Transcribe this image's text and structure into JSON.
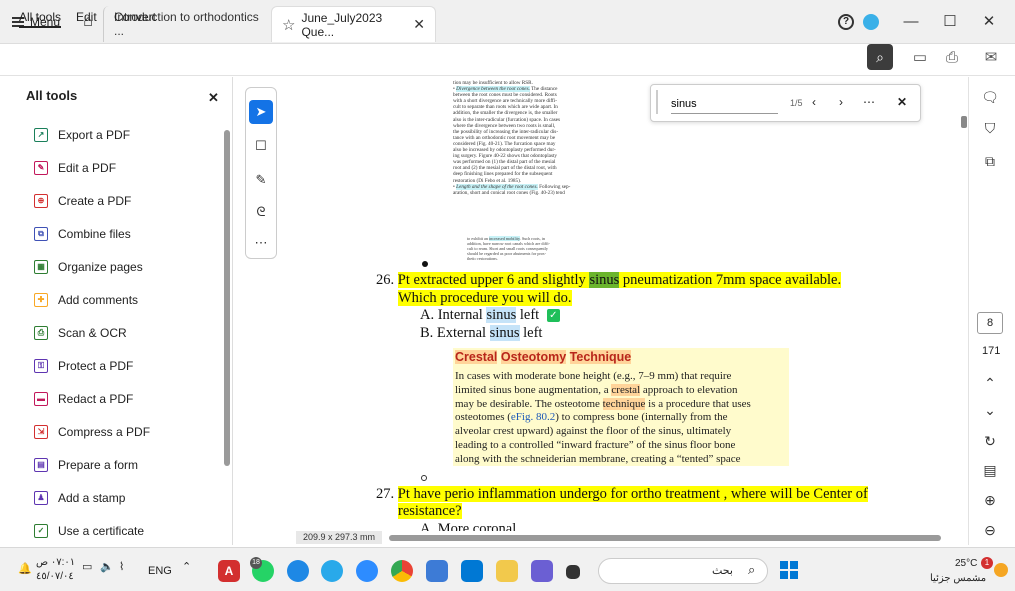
{
  "titlebar": {
    "menu_label": "Menu",
    "tabs": [
      {
        "label": "Introduction to orthodontics ..."
      },
      {
        "label": "June_July2023 Que..."
      }
    ],
    "window_controls": [
      "minimize",
      "maximize",
      "close"
    ]
  },
  "menubar": {
    "items": [
      "All tools",
      "Edit",
      "Convert"
    ]
  },
  "left_panel": {
    "title": "All tools",
    "tools": [
      {
        "label": "Export a PDF",
        "icon": "export-pdf-icon",
        "color": "#1a7f5a"
      },
      {
        "label": "Edit a PDF",
        "icon": "edit-pdf-icon",
        "color": "#c2185b"
      },
      {
        "label": "Create a PDF",
        "icon": "create-pdf-icon",
        "color": "#d32f2f"
      },
      {
        "label": "Combine files",
        "icon": "combine-files-icon",
        "color": "#3f51b5"
      },
      {
        "label": "Organize pages",
        "icon": "organize-pages-icon",
        "color": "#2e7d32"
      },
      {
        "label": "Add comments",
        "icon": "add-comments-icon",
        "color": "#f9a825"
      },
      {
        "label": "Scan & OCR",
        "icon": "scan-ocr-icon",
        "color": "#2e7d32"
      },
      {
        "label": "Protect a PDF",
        "icon": "protect-pdf-icon",
        "color": "#5e35b1"
      },
      {
        "label": "Redact a PDF",
        "icon": "redact-pdf-icon",
        "color": "#c2185b"
      },
      {
        "label": "Compress a PDF",
        "icon": "compress-pdf-icon",
        "color": "#d32f2f"
      },
      {
        "label": "Prepare a form",
        "icon": "prepare-form-icon",
        "color": "#5e35b1"
      },
      {
        "label": "Add a stamp",
        "icon": "add-stamp-icon",
        "color": "#5e35b1"
      },
      {
        "label": "Use a certificate",
        "icon": "certificate-icon",
        "color": "#2e7d32"
      }
    ]
  },
  "find": {
    "query": "sinus",
    "count": "1/5"
  },
  "document": {
    "scan_lines": [
      "tion may be insufficient to allow RSR.",
      "The distance",
      "between the root cones must be considered. Roots",
      "with a short divergence are technically more diffi-",
      "cult to separate than roots which are wide apart. In",
      "addition, the smaller the divergence is, the smaller",
      "also is the inter-radicular (furcation) space. In cases",
      "where the divergence between two roots is small,",
      "the possibility of increasing the inter-radicular dis-",
      "tance with an orthodontic root movement may be",
      "considered (Fig. 40-21). The furcation space may",
      "also be increased by odontoplasty performed dur-",
      "ing surgery. Figure 40-22 shows that odontoplasty",
      "was performed on (1) the distal part of the mesial",
      "root and (2) the mesial part of the distal root, with",
      "deep finishing lines prepared for the subsequent",
      "restoration (Di Febo et al. 1985).",
      "Following sep-",
      "aration, short and conical root cones (Fig. 40-23) tend"
    ],
    "scan_highlights": [
      "Divergence between the root cones.",
      "Length and the shape of the root cones."
    ],
    "scan_note": [
      "to exhibit an",
      "increased mobility",
      ". Such roots, in",
      "addition, have narrow root canals which are diffi-",
      "cult to ream. Short and small roots consequently",
      "should be regarded as poor abutments for pros-",
      "thetic restorations."
    ],
    "q26": {
      "num": "26.",
      "text_a": "Pt extracted upper 6 and slightly",
      "hl": "sinus",
      "text_b": " pneumatization 7mm space available.",
      "line2": "Which procedure you will do.",
      "option_a_prefix": "A.  Internal ",
      "option_a_hl": "sinus",
      "option_a_suffix": " left",
      "option_b_prefix": "B.  External ",
      "option_b_hl": "sinus",
      "option_b_suffix": " left"
    },
    "crestal": {
      "title_1": "Crestal",
      "title_2": "Osteotomy",
      "title_3": "Technique",
      "line1": "In cases with moderate bone height (e.g., 7–9 mm) that require",
      "line2a": "limited sinus bone augmentation, a ",
      "line2b": "crestal",
      "line2c": " approach to elevation",
      "line3a": "may be desirable. The osteotome ",
      "line3b": "technique",
      "line3c": " is a procedure that uses",
      "line4a": "osteotomes (",
      "line4b": "eFig. 80.2",
      "line4c": ") to compress bone (internally from the",
      "line5": "alveolar crest upward) against the floor of the sinus, ultimately",
      "line6": "leading to a controlled “inward fracture” of the sinus floor bone",
      "line7": "along with the schneiderian membrane, creating a “tented” space"
    },
    "q27": {
      "num": "27.",
      "line1": "Pt have perio inflammation undergo for ortho treatment , where will be Center of",
      "line2": "resistance?",
      "option_a": "A.  More coronal"
    },
    "page_size": "209.9 x 297.3 mm"
  },
  "right_rail": {
    "current_page": "8",
    "total_pages": "171"
  },
  "taskbar": {
    "time": "٠٧:٠١ ص",
    "date": "٤٥/٠٧/٠٤",
    "language": "ENG",
    "search_text": "بحث",
    "whatsapp_badge": "18",
    "weather_temp": "25°C",
    "weather_desc": "مشمس جزئيا",
    "weather_badge": "1"
  }
}
